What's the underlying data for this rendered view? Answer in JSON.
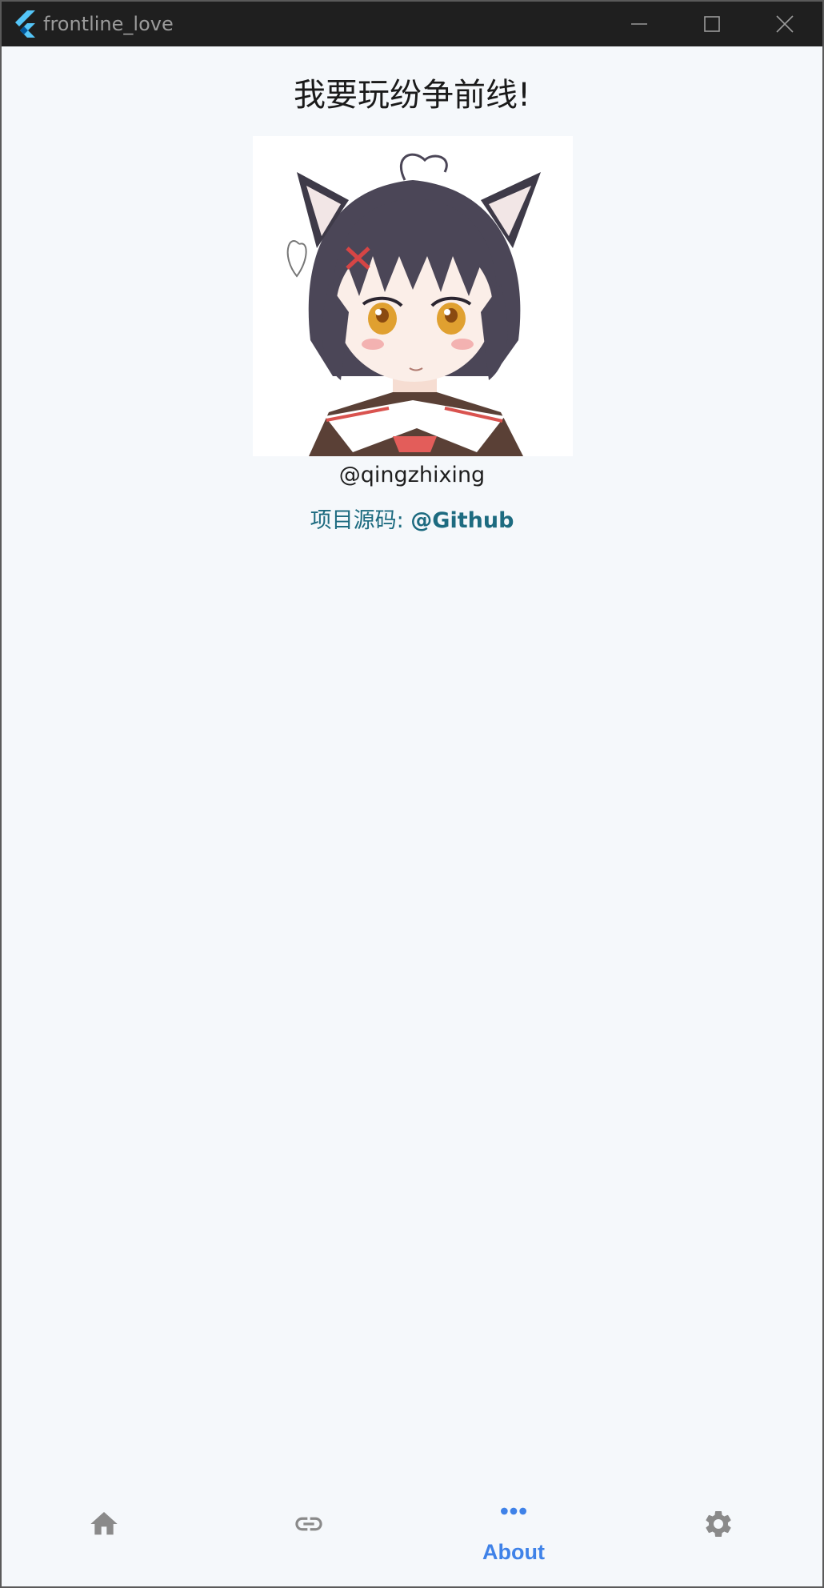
{
  "window": {
    "title": "frontline_love",
    "controls": {
      "minimize": "minimize-icon",
      "maximize": "maximize-icon",
      "close": "close-icon"
    }
  },
  "main": {
    "heading": "我要玩纷争前线!",
    "avatar_alt": "avatar",
    "handle": "@qingzhixing",
    "source_label": "项目源码: ",
    "source_link": "@Github"
  },
  "nav": {
    "items": [
      {
        "icon": "home-icon",
        "label": "",
        "active": false
      },
      {
        "icon": "link-icon",
        "label": "",
        "active": false
      },
      {
        "icon": "more-horizontal-icon",
        "label": "About",
        "active": true
      },
      {
        "icon": "gear-icon",
        "label": "",
        "active": false
      }
    ]
  },
  "colors": {
    "active": "#3f82e8",
    "inactive": "#8a8a8a",
    "link": "#1d6b80",
    "background": "#f5f8fb",
    "titlebar": "#1f1f1f"
  }
}
